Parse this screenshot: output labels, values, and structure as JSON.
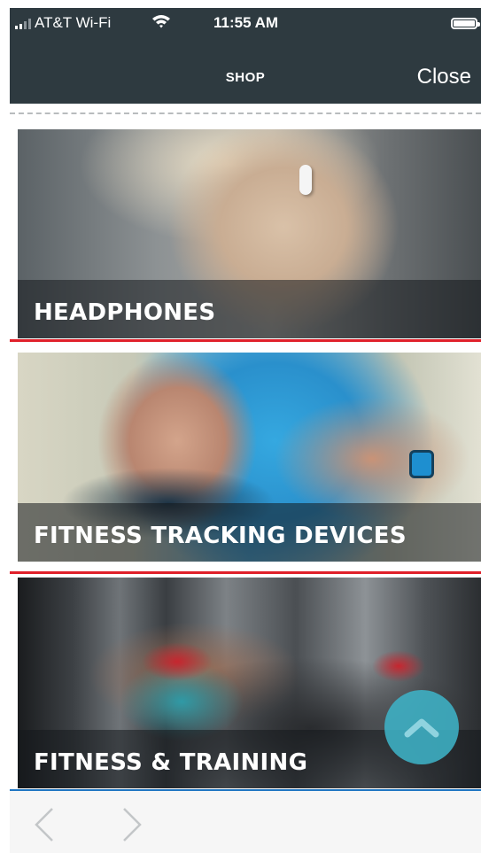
{
  "status_bar": {
    "carrier": "AT&T Wi-Fi",
    "time": "11:55 AM"
  },
  "header": {
    "title": "SHOP",
    "close_label": "Close"
  },
  "categories": [
    {
      "label": "HEADPHONES"
    },
    {
      "label": "FITNESS TRACKING DEVICES"
    },
    {
      "label": "FITNESS & TRAINING"
    }
  ],
  "colors": {
    "header_bg": "#2e3a40",
    "highlight": "#e0202a",
    "accent_blue": "#1f76c2",
    "scroll_button": "#3eb2c6"
  },
  "icons": {
    "signal": "signal-icon",
    "wifi": "wifi-icon",
    "battery": "battery-icon",
    "scroll_top": "chevron-up-icon",
    "back": "chevron-left-icon",
    "forward": "chevron-right-icon"
  }
}
